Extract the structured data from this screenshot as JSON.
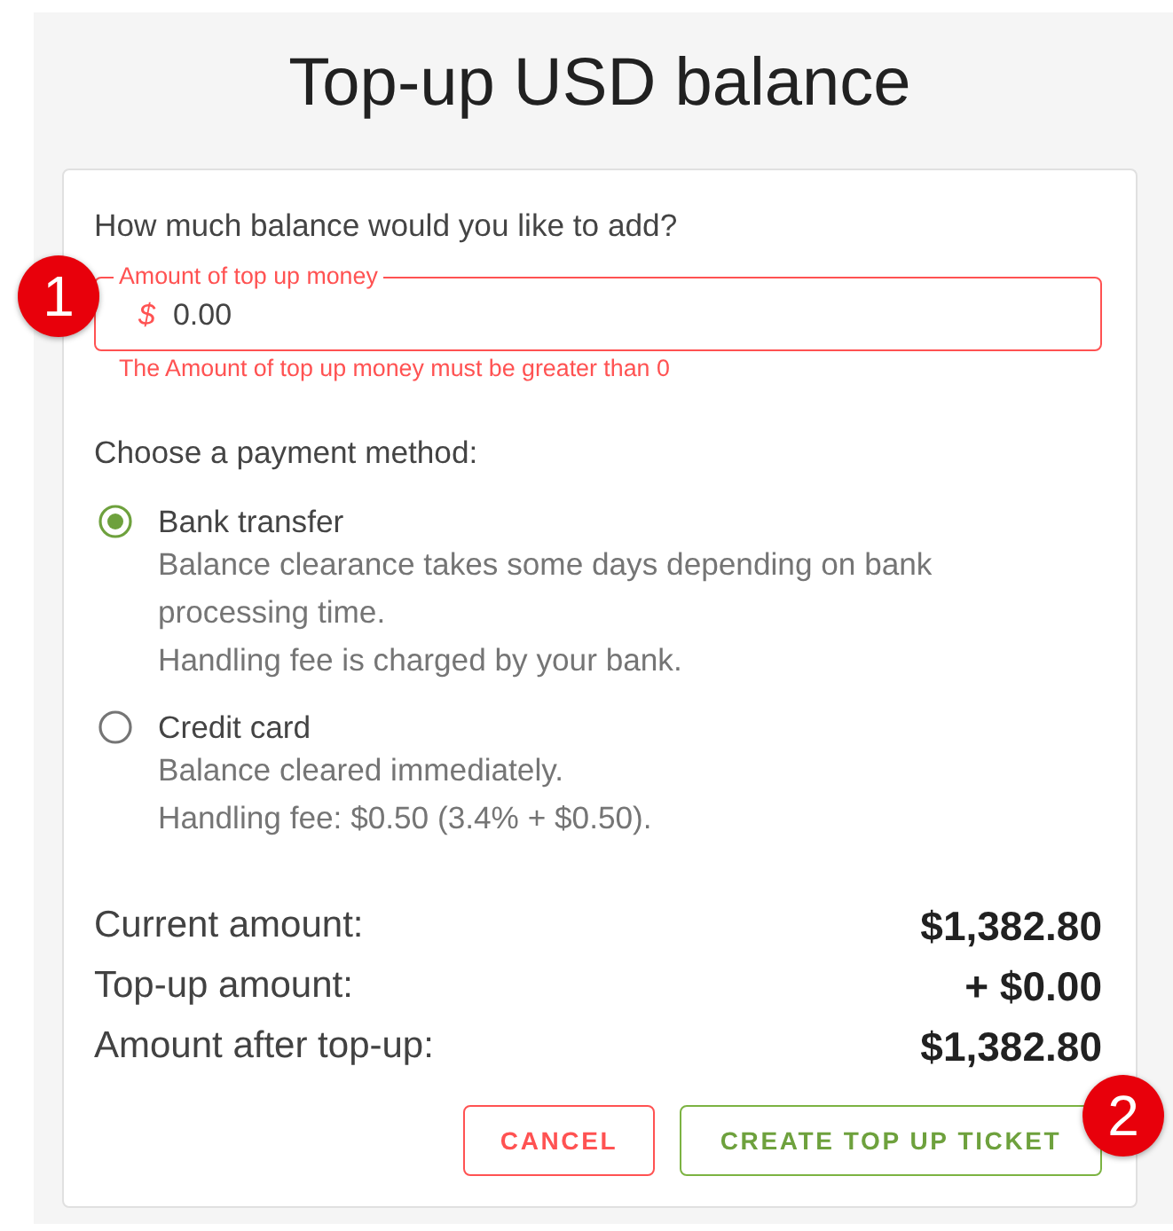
{
  "title": "Top-up USD balance",
  "amount": {
    "question": "How much balance would you like to add?",
    "field": {
      "label": "Amount of top up money",
      "prefix": "$",
      "value": "0.00",
      "error": true,
      "error_text": "The Amount of top up money must be greater than 0",
      "marker": "1"
    }
  },
  "payment": {
    "heading": "Choose a payment method:",
    "options": [
      {
        "label": "Bank transfer",
        "selected": true,
        "description": [
          "Balance clearance takes some days depending on bank processing time.",
          "Handling fee is charged by your bank."
        ]
      },
      {
        "label": "Credit card",
        "selected": false,
        "description": [
          "Balance cleared immediately.",
          "Handling fee: $0.50 (3.4% + $0.50)."
        ]
      }
    ]
  },
  "summary": [
    {
      "label": "Current amount:",
      "value": "$1,382.80"
    },
    {
      "label": "Top-up amount:",
      "value": "+ $0.00"
    },
    {
      "label": "Amount after top-up:",
      "value": "$1,382.80"
    }
  ],
  "buttons": [
    {
      "label": "CANCEL",
      "kind": "cancel"
    },
    {
      "label": "CREATE TOP UP TICKET",
      "kind": "confirm",
      "marker": "2"
    }
  ]
}
